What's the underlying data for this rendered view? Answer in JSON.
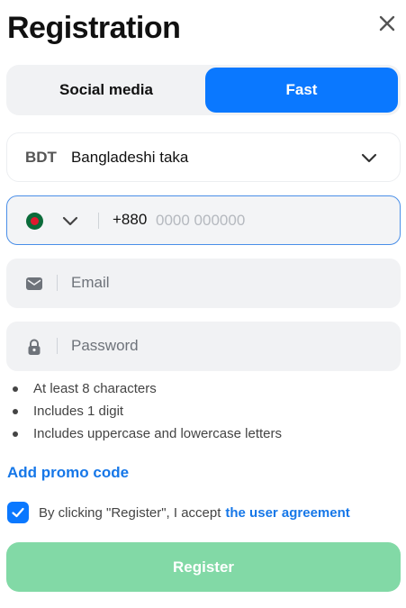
{
  "header": {
    "title": "Registration"
  },
  "tabs": [
    {
      "label": "Social media",
      "active": false
    },
    {
      "label": "Fast",
      "active": true
    }
  ],
  "currency": {
    "code": "BDT",
    "name": "Bangladeshi taka"
  },
  "phone": {
    "country_code": "+880",
    "placeholder": "0000 000000",
    "flag": "bangladesh-flag-icon"
  },
  "email": {
    "placeholder": "Email"
  },
  "password": {
    "placeholder": "Password"
  },
  "password_rules": [
    "At least 8 characters",
    "Includes 1 digit",
    "Includes uppercase and lowercase letters"
  ],
  "promo": {
    "label": "Add promo code"
  },
  "agreement": {
    "text": "By clicking \"Register\", I accept",
    "link": "the user agreement",
    "checked": true
  },
  "register": {
    "label": "Register"
  },
  "colors": {
    "accent": "#0a78ff",
    "link": "#1677e8",
    "register_disabled": "#82d9a6",
    "field_bg": "#f1f2f4"
  }
}
